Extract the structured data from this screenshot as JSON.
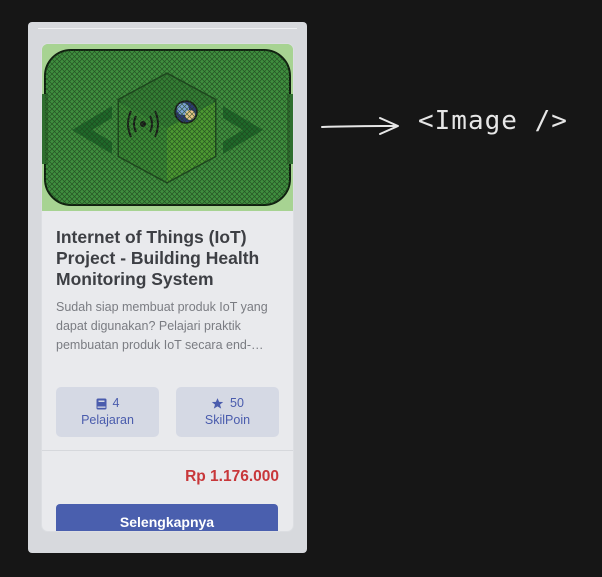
{
  "course_card": {
    "image_icon": "iot-cube-illustration",
    "title": "Internet of Things (IoT) Project - Building Health Monitoring System",
    "description": "Sudah siap membuat produk IoT yang dapat digunakan? Pelajari praktik pembuatan produk IoT secara end-…",
    "lessons": {
      "icon": "book-icon",
      "value": "4",
      "label": "Pelajaran"
    },
    "points": {
      "icon": "star-icon",
      "value": "50",
      "label": "SkilPoin"
    },
    "price": "Rp 1.176.000",
    "cta_label": "Selengkapnya"
  },
  "annotation": {
    "arrow_icon": "right-arrow-icon",
    "label": "<Image />"
  },
  "colors": {
    "accent": "#4a5fae",
    "price": "#c8373a",
    "stat_bg": "#d5d9e4",
    "thumb_green": "#a7d392",
    "background": "#161616"
  }
}
